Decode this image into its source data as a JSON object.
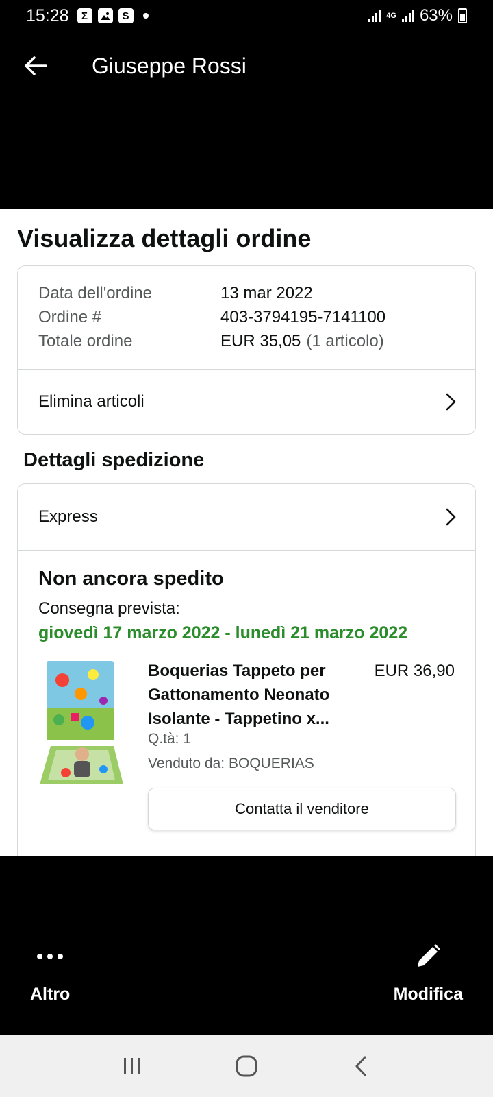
{
  "status_bar": {
    "time": "15:28",
    "notification_icons": [
      "sigma-icon",
      "image-icon",
      "s-icon"
    ],
    "network": "4G",
    "battery": "63%"
  },
  "app_bar": {
    "back_icon": "arrow-left-icon",
    "title": "Giuseppe Rossi"
  },
  "page": {
    "title": "Visualizza dettagli ordine"
  },
  "order_summary": {
    "rows": [
      {
        "label": "Data dell'ordine",
        "value": "13 mar 2022",
        "extra": ""
      },
      {
        "label": "Ordine #",
        "value": "403-3794195-7141100",
        "extra": ""
      },
      {
        "label": "Totale ordine",
        "value": "EUR 35,05",
        "extra": "(1 articolo)"
      }
    ],
    "delete_items_label": "Elimina articoli"
  },
  "shipping": {
    "section_title": "Dettagli spedizione",
    "method": "Express",
    "status": "Non ancora spedito",
    "delivery_label": "Consegna prevista:",
    "delivery_date": "giovedì 17 marzo 2022 - lunedì 21 marzo 2022",
    "product": {
      "title": "Boquerias Tappeto per Gattonamento Neonato Isolante - Tappetino x...",
      "price": "EUR 36,90",
      "quantity": "Q.tà: 1",
      "seller": "Venduto da: BOQUERIAS",
      "contact_button": "Contatta il venditore"
    }
  },
  "bottom_actions": {
    "more_label": "Altro",
    "edit_label": "Modifica"
  },
  "colors": {
    "delivery_green": "#2a8c2a",
    "border": "#d5d9d9",
    "secondary_text": "#565959"
  }
}
